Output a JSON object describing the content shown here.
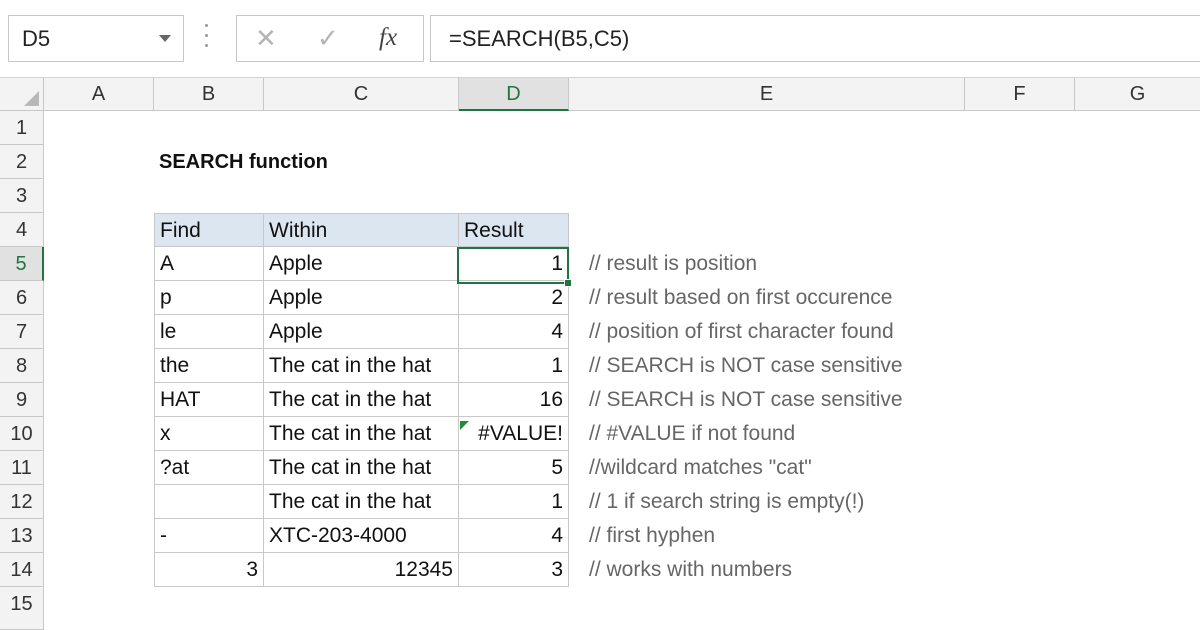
{
  "formula_bar": {
    "name_box": "D5",
    "cancel_icon": "✕",
    "enter_icon": "✓",
    "fx_label": "fx",
    "formula": "=SEARCH(B5,C5)"
  },
  "columns": [
    "A",
    "B",
    "C",
    "D",
    "E",
    "F",
    "G"
  ],
  "active_column": "D",
  "rows": [
    "1",
    "2",
    "3",
    "4",
    "5",
    "6",
    "7",
    "8",
    "9",
    "10",
    "11",
    "12",
    "13",
    "14",
    "15"
  ],
  "active_row": "5",
  "sheet": {
    "title": "SEARCH function",
    "table_headers": {
      "find": "Find",
      "within": "Within",
      "result": "Result"
    },
    "table_rows": [
      {
        "find": "A",
        "within": "Apple",
        "result": "1",
        "comment": "// result is position"
      },
      {
        "find": "p",
        "within": "Apple",
        "result": "2",
        "comment": "// result based on first occurence"
      },
      {
        "find": "le",
        "within": "Apple",
        "result": "4",
        "comment": "// position of first character found"
      },
      {
        "find": "the",
        "within": "The cat in the hat",
        "result": "1",
        "comment": "// SEARCH is NOT case sensitive"
      },
      {
        "find": "HAT",
        "within": "The cat in the hat",
        "result": "16",
        "comment": "// SEARCH is NOT case sensitive"
      },
      {
        "find": "x",
        "within": "The cat in the hat",
        "result": "#VALUE!",
        "comment": "// #VALUE if not found"
      },
      {
        "find": "?at",
        "within": "The cat in the hat",
        "result": "5",
        "comment": "//wildcard matches \"cat\""
      },
      {
        "find": "",
        "within": "The cat in the hat",
        "result": "1",
        "comment": "// 1 if search string is empty(!)"
      },
      {
        "find": "-",
        "within": "XTC-203-4000",
        "result": "4",
        "comment": "// first hyphen"
      },
      {
        "find": "3",
        "within": "12345",
        "result": "3",
        "comment": "// works with numbers"
      }
    ]
  },
  "colors": {
    "accent": "#217346",
    "header_fill": "#dce6f1",
    "comment_text": "#666666"
  }
}
